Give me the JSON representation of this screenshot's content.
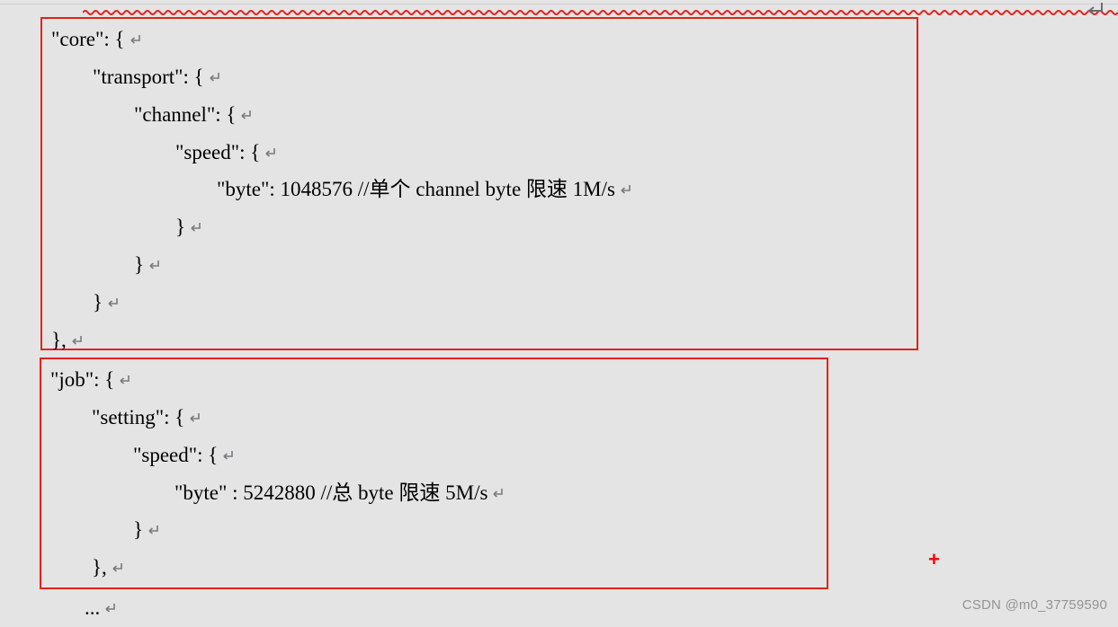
{
  "core": {
    "lines": [
      "\"core\": {",
      "        \"transport\": {",
      "                \"channel\": {",
      "                        \"speed\": {",
      "                                \"byte\": 1048576 //单个 channel byte 限速 1M/s",
      "                        }",
      "                }",
      "        }",
      "},"
    ]
  },
  "job": {
    "lines": [
      "\"job\": {",
      "        \"setting\": {",
      "                \"speed\": {",
      "                        \"byte\" : 5242880 //总 byte 限速 5M/s",
      "                }",
      "        },"
    ]
  },
  "trailing_line": "        ...",
  "plus_mark": "+",
  "watermark": "CSDN @m0_37759590"
}
